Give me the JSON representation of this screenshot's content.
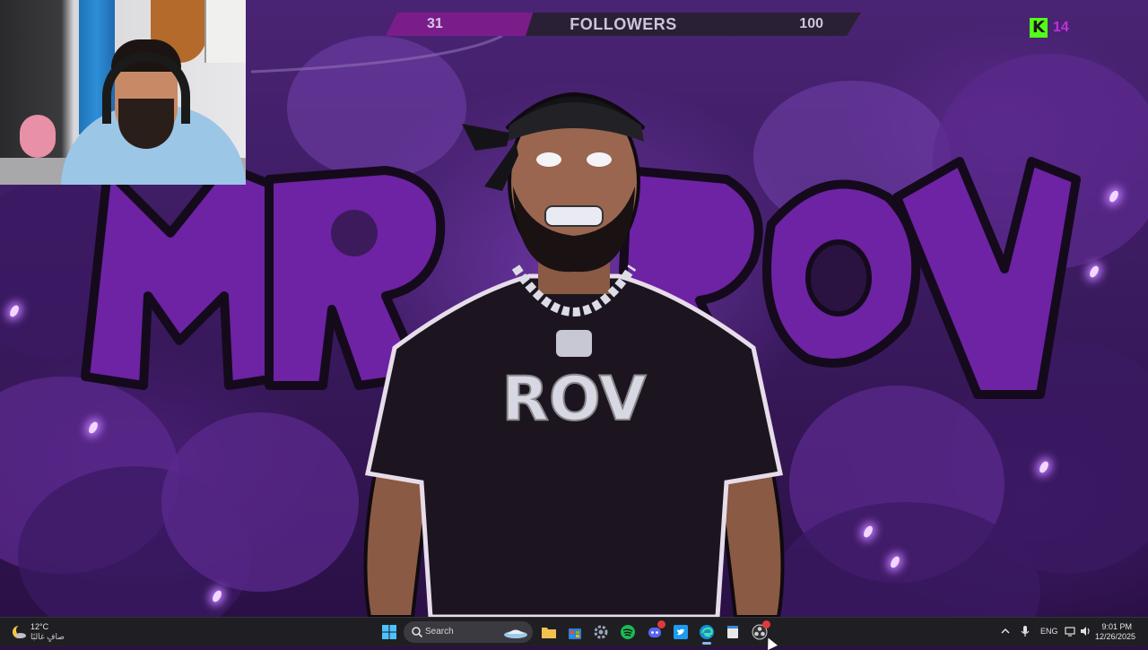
{
  "stream_overlay": {
    "follower_goal": {
      "current": "31",
      "label": "FOLLOWERS",
      "target": "100",
      "progress": 0.31
    },
    "kick": {
      "logo_letter": "K",
      "count": "14",
      "brand_color": "#53fc18",
      "count_color": "#c030d8"
    },
    "graffiti_text": "MR ROV",
    "shirt_text": "ROV"
  },
  "taskbar": {
    "weather": {
      "temperature": "12°C",
      "description": "صافٍ غالبًا"
    },
    "search": {
      "placeholder": "Search"
    },
    "pinned_apps": [
      {
        "name": "file-explorer"
      },
      {
        "name": "microsoft-store"
      },
      {
        "name": "settings"
      },
      {
        "name": "spotify"
      },
      {
        "name": "discord"
      },
      {
        "name": "twitter"
      },
      {
        "name": "edge"
      },
      {
        "name": "notepad"
      },
      {
        "name": "obs"
      }
    ],
    "tray": {
      "language": "ENG",
      "time": "9:01 PM",
      "date": "12/26/2025"
    }
  },
  "colors": {
    "accent_purple": "#7a1d8a",
    "taskbar_bg": "#1f1f23"
  }
}
